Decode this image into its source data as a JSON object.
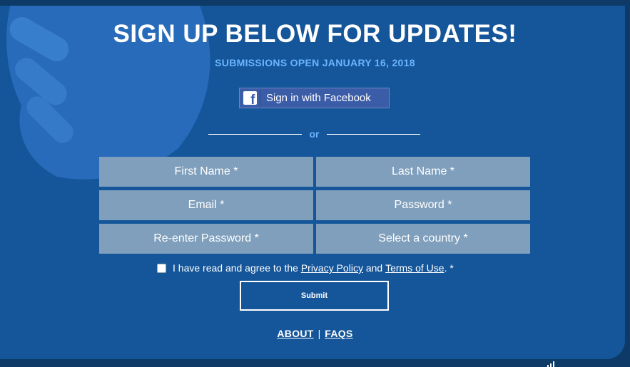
{
  "header": {
    "title": "SIGN UP BELOW FOR UPDATES!",
    "subtitle": "SUBMISSIONS OPEN JANUARY 16, 2018"
  },
  "facebook": {
    "label": "Sign in with Facebook",
    "icon": "facebook-icon"
  },
  "divider": {
    "label": "or"
  },
  "form": {
    "first_name": "First Name *",
    "last_name": "Last Name *",
    "email": "Email *",
    "password": "Password *",
    "reenter_password": "Re-enter Password *",
    "country": "Select a country *"
  },
  "agreement": {
    "prefix": "I have read and agree to the",
    "privacy": "Privacy Policy",
    "and": "and",
    "terms": "Terms of Use",
    "suffix": ". *",
    "checked": false
  },
  "submit": {
    "label": "Submit"
  },
  "footer": {
    "about": "ABOUT",
    "separator": "|",
    "faqs": "FAQS"
  },
  "colors": {
    "background": "#0d3a66",
    "panel": "#15569a",
    "accent": "#6ab4ff",
    "field": "#7f9fbc",
    "facebook": "#3b5da8"
  }
}
